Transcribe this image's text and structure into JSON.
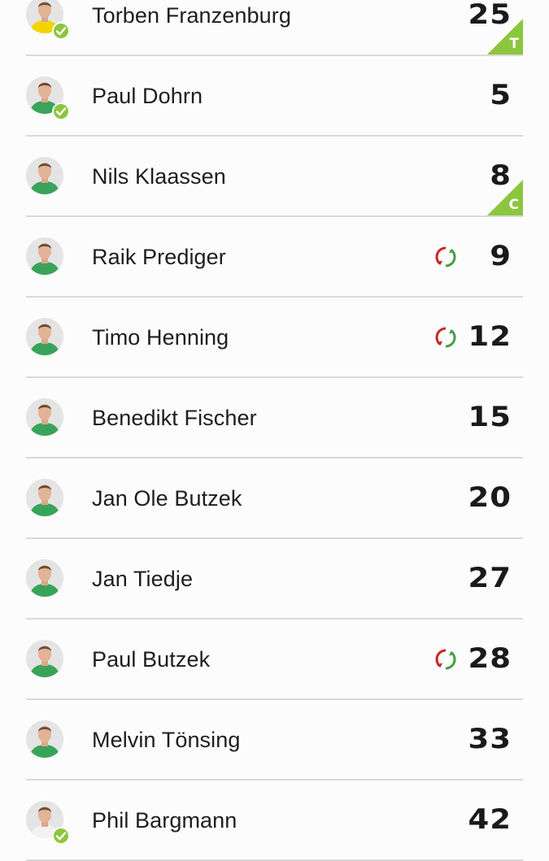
{
  "players": [
    {
      "name": "Torben Franzenburg",
      "number": "25",
      "checked": true,
      "sub": false,
      "badge": "T",
      "kit": "yellow"
    },
    {
      "name": "Paul Dohrn",
      "number": "5",
      "checked": true,
      "sub": false,
      "badge": "",
      "kit": "green"
    },
    {
      "name": "Nils Klaassen",
      "number": "8",
      "checked": false,
      "sub": false,
      "badge": "C",
      "kit": "green"
    },
    {
      "name": "Raik Prediger",
      "number": "9",
      "checked": false,
      "sub": true,
      "badge": "",
      "kit": "green"
    },
    {
      "name": "Timo Henning",
      "number": "12",
      "checked": false,
      "sub": true,
      "badge": "",
      "kit": "green"
    },
    {
      "name": "Benedikt Fischer",
      "number": "15",
      "checked": false,
      "sub": false,
      "badge": "",
      "kit": "green"
    },
    {
      "name": "Jan Ole Butzek",
      "number": "20",
      "checked": false,
      "sub": false,
      "badge": "",
      "kit": "green"
    },
    {
      "name": "Jan Tiedje",
      "number": "27",
      "checked": false,
      "sub": false,
      "badge": "",
      "kit": "green"
    },
    {
      "name": "Paul Butzek",
      "number": "28",
      "checked": false,
      "sub": true,
      "badge": "",
      "kit": "green"
    },
    {
      "name": "Melvin Tönsing",
      "number": "33",
      "checked": false,
      "sub": false,
      "badge": "",
      "kit": "green"
    },
    {
      "name": "Phil Bargmann",
      "number": "42",
      "checked": true,
      "sub": false,
      "badge": "",
      "kit": "white"
    }
  ],
  "colors": {
    "accent_green": "#8cc63f",
    "sub_red": "#c62828",
    "sub_green": "#43a047",
    "kit_green": "#3aa35a",
    "kit_yellow": "#f2d400",
    "kit_white": "#f2f2f2"
  },
  "icons": {
    "check": "check-icon",
    "substitution": "substitution-icon",
    "avatar": "player-avatar"
  }
}
